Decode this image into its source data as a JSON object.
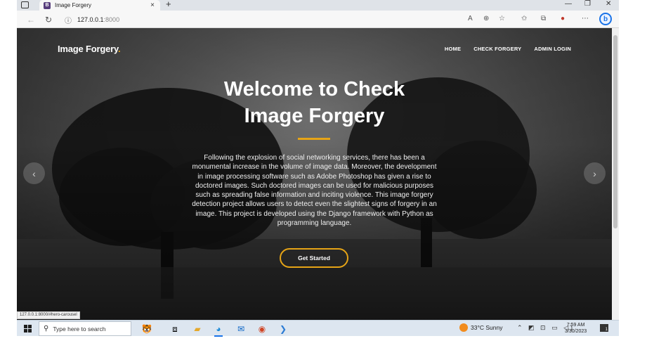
{
  "browser": {
    "tab_title": "Image Forgery",
    "tab_favicon": "B",
    "url_host": "127.0.0.1",
    "url_port": ":8000",
    "new_tab": "+",
    "close_tab": "×",
    "bing": "b",
    "status_url": "127.0.0.1:8000/#hero-carousel"
  },
  "site": {
    "brand": "Image Forgery",
    "brand_dot": ".",
    "nav": {
      "home": "HOME",
      "check": "CHECK FORGERY",
      "admin": "ADMIN LOGIN"
    }
  },
  "hero": {
    "title_line1": "Welcome to Check",
    "title_line2": "Image Forgery",
    "description": "Following the explosion of social networking services, there has been a monumental increase in the volume of image data. Moreover, the development in image processing software such as Adobe Photoshop has given a rise to doctored images. Such doctored images can be used for malicious purposes such as spreading false information and inciting violence. This image forgery detection project allows users to detect even the slightest signs of forgery in an image. This project is developed using the Django framework with Python as programming language.",
    "cta": "Get Started",
    "accent": "#e6a416"
  },
  "taskbar": {
    "search_placeholder": "Type here to search",
    "weather": "33°C  Sunny",
    "time": "7:59 AM",
    "date": "3/30/2023",
    "notifications": "1"
  }
}
